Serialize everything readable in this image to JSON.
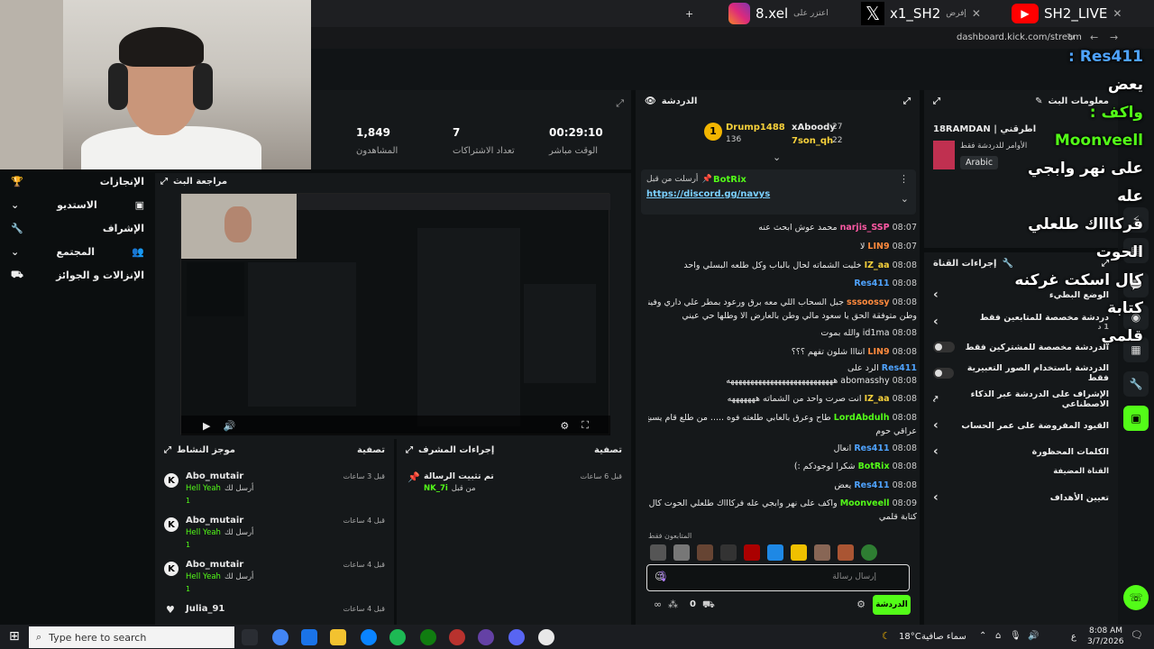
{
  "browser": {
    "tabs": [
      {
        "label": "SH2_LIVE",
        "active": true
      },
      {
        "label": "x1_SH2",
        "active": false
      },
      {
        "label": "8.xel",
        "active": false
      }
    ],
    "tab_sub_1": "إفرض",
    "tab_sub_2": "اعتزر على",
    "url": "dashboard.kick.com/stream",
    "new_tab": "+"
  },
  "leftnav": {
    "items": [
      {
        "label": "الإنجازات"
      },
      {
        "label": "الاستديو"
      },
      {
        "label": "الإشراف"
      },
      {
        "label": "المجتمع"
      },
      {
        "label": "الإنزالات و الجوائز"
      }
    ]
  },
  "stats": {
    "viewers_value": "1,849",
    "viewers_label": "المشاهدون",
    "subs_value": "7",
    "subs_label": "تعداد الاشتراكات",
    "live_value": "00:29:10",
    "live_label": "الوقت مباشر"
  },
  "review": {
    "title": "مراجعة البث"
  },
  "activity": {
    "title": "موجز النشاط",
    "filter": "تصفية",
    "rows": [
      {
        "user": "Abo_mutair",
        "time": "قبل 3 ساعات",
        "text": "أرسل لك",
        "highlight": "Hell Yeah",
        "count": "1"
      },
      {
        "user": "Abo_mutair",
        "time": "قبل 4 ساعات",
        "text": "أرسل لك",
        "highlight": "Hell Yeah",
        "count": "1"
      },
      {
        "user": "Abo_mutair",
        "time": "قبل 4 ساعات",
        "text": "أرسل لك",
        "highlight": "Hell Yeah",
        "count": "1"
      },
      {
        "user": "Julia_91",
        "time": "قبل 4 ساعات"
      }
    ]
  },
  "moderation": {
    "title": "إجراءات المشرف",
    "filter": "تصفية",
    "pinned": "تم تثبيت الرسالة",
    "by": "من قبل",
    "by_user": "NK_7i",
    "time": "قبل 6 ساعات"
  },
  "chat": {
    "title": "الدردشة",
    "top_gifters": [
      {
        "rank": "1",
        "name": "Drump1488",
        "count": "136"
      },
      {
        "name": "xAboody",
        "count": "27"
      },
      {
        "name": "7son_qh",
        "count": "22"
      }
    ],
    "pinned_by_label": "أرسلت من قبل",
    "pinned_user": "BotRix",
    "pinned_link": "https://discord.gg/navys",
    "messages": [
      {
        "time": "08:07",
        "user": "narjis_SSP",
        "text": "محمد عوش ابحث عنه",
        "color": "pink"
      },
      {
        "time": "08:07",
        "user": "LIN9",
        "text": "لا",
        "color": "orange"
      },
      {
        "time": "08:08",
        "user": "IZ_aa",
        "text": "خليت الشماته لحال بالباب وكل طلعه البسلي واحد",
        "color": "yellow"
      },
      {
        "time": "08:08",
        "user": "Res411",
        "text": "",
        "color": "blue"
      },
      {
        "time": "08:08",
        "user": "sssoossy",
        "text": "جبل السحاب اللي معه برق ورعود بمطر علي داري وفيني سكبها يسقي",
        "color": "orange"
      },
      {
        "time": "",
        "user": "",
        "text": "وطن متوفقة الحق يا سعود مالي وطن بالعارض الا وطلها حي عيني",
        "color": ""
      },
      {
        "time": "08:08",
        "user": "id1ma",
        "text": "والله بموت",
        "color": "white"
      },
      {
        "time": "08:08",
        "user": "LIN9",
        "text": "انتااا شلون تفهم ؟؟؟",
        "color": "orange"
      },
      {
        "time": "",
        "user": "Res411",
        "text": "الرد على",
        "color": "blue"
      },
      {
        "time": "08:08",
        "user": "abomasshy",
        "text": "هههههههههههههههههههههههههههه",
        "color": "white"
      },
      {
        "time": "08:08",
        "user": "IZ_aa",
        "text": "انت صرت واحد من الشماته هههههههه",
        "color": "yellow"
      },
      {
        "time": "08:08",
        "user": "LordAbdulh",
        "text": "طاح وعرق بالعابي طلعته فوه ..... من طلع قام يسبح",
        "color": "green"
      },
      {
        "time": "",
        "user": "",
        "text": "عراقي حوم",
        "color": ""
      },
      {
        "time": "08:08",
        "user": "Res411",
        "text": "انعال",
        "color": "blue"
      },
      {
        "time": "08:08",
        "user": "BotRix",
        "text": "شكرا لوجودكم :)",
        "color": "green"
      },
      {
        "time": "08:08",
        "user": "Res411",
        "text": "يعض",
        "color": "blue"
      },
      {
        "time": "08:09",
        "user": "Moonveell",
        "text": "واكف على نهر وابجي عله فركاااك طلعلي الحوت كال اسكت غركته",
        "color": "green"
      },
      {
        "time": "",
        "user": "",
        "text": "كتابة قلمي",
        "color": ""
      }
    ],
    "followers_only": "المتابعون فقط",
    "input_placeholder": "إرسال رسالة",
    "send_button": "الدردشة",
    "viewer_count": "0"
  },
  "info": {
    "title": "معلومات البث",
    "stream_title": "18RAMDAN | اطرقني",
    "sub_title": "الأوامر للدردشة فقط",
    "language": "Arabic"
  },
  "actions": {
    "title": "إجراءات القناة",
    "rows": [
      {
        "label": "الوضع البطيء",
        "type": "chevron"
      },
      {
        "label": "دردشة مخصصة للمتابعين فقط",
        "sub": "1 د",
        "type": "chevron"
      },
      {
        "label": "الدردشة مخصصة للمشتركين فقط",
        "type": "toggle"
      },
      {
        "label": "الدردشة باستخدام الصور التعبيرية فقط",
        "type": "toggle"
      },
      {
        "label": "الإشراف على الدردشة عبر الذكاء الاصطناعي",
        "type": "link"
      },
      {
        "label": "القيود المفروضة على عمر الحساب",
        "type": "chevron"
      },
      {
        "label": "الكلمات المحظورة",
        "type": "chevron"
      },
      {
        "label": "القناة المضيفة",
        "type": "none"
      },
      {
        "label": "تعيين الأهداف",
        "type": "chevron"
      }
    ]
  },
  "overlay": {
    "lines": [
      "Res411 :",
      "يعض",
      "واكف : Moonveell",
      "على نهر وابجي عله",
      "فركاااك طلعلي الحوت",
      "كال اسكت غركنه كتابة",
      "قلمي"
    ]
  },
  "taskbar": {
    "search_placeholder": "Type here to search",
    "weather_temp": "18°C",
    "weather_text": "سماء صافية",
    "lang": "ع",
    "time": "8:08 AM",
    "date": "3/7/2026"
  },
  "colors": {
    "accent": "#53fc18",
    "panel": "#15181a",
    "bg": "#0b0e0f"
  }
}
